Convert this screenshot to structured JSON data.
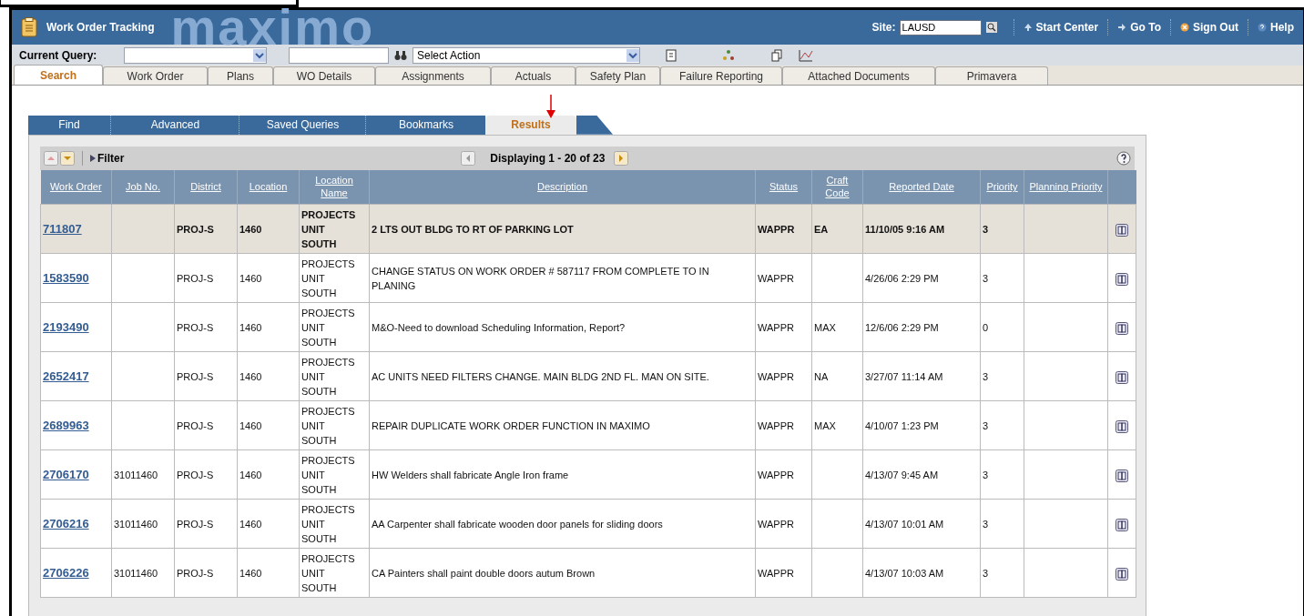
{
  "app": {
    "title": "Work Order Tracking",
    "brand": "maximo"
  },
  "site": {
    "label": "Site:",
    "value": "LAUSD"
  },
  "nav_links": [
    {
      "label": "Start Center",
      "kind": "home"
    },
    {
      "label": "Go To",
      "kind": "goto"
    },
    {
      "label": "Sign Out",
      "kind": "signout"
    },
    {
      "label": "Help",
      "kind": "help"
    }
  ],
  "query_bar": {
    "label": "Current Query:",
    "action": "Select Action"
  },
  "tabs": [
    {
      "label": "Search",
      "selected": true
    },
    {
      "label": "Work Order",
      "selected": false
    },
    {
      "label": "Plans",
      "selected": false
    },
    {
      "label": "WO Details",
      "selected": false
    },
    {
      "label": "Assignments",
      "selected": false
    },
    {
      "label": "Actuals",
      "selected": false
    },
    {
      "label": "Safety Plan",
      "selected": false
    },
    {
      "label": "Failure Reporting",
      "selected": false
    },
    {
      "label": "Attached Documents",
      "selected": false
    },
    {
      "label": "Primavera",
      "selected": false
    }
  ],
  "subtabs": [
    {
      "label": "Find",
      "selected": false
    },
    {
      "label": "Advanced",
      "selected": false
    },
    {
      "label": "Saved Queries",
      "selected": false
    },
    {
      "label": "Bookmarks",
      "selected": false
    },
    {
      "label": "Results",
      "selected": true
    }
  ],
  "results": {
    "filter": "Filter",
    "paging": "Displaying 1 - 20 of 23",
    "columns": [
      "Work Order",
      "Job No.",
      "District",
      "Location",
      "Location Name",
      "Description",
      "Status",
      "Craft Code",
      "Reported Date",
      "Priority",
      "Planning Priority"
    ],
    "rows": [
      {
        "selected": true,
        "cells": [
          "711807",
          "",
          "PROJ-S",
          "1460",
          "PROJECTS UNIT SOUTH",
          "2 LTS OUT BLDG TO RT OF PARKING LOT",
          "WAPPR",
          "EA",
          "11/10/05 9:16 AM",
          "3",
          ""
        ]
      },
      {
        "selected": false,
        "cells": [
          "1583590",
          "",
          "PROJ-S",
          "1460",
          "PROJECTS UNIT SOUTH",
          "CHANGE STATUS ON WORK ORDER # 587117 FROM COMPLETE TO IN PLANING",
          "WAPPR",
          "",
          "4/26/06 2:29 PM",
          "3",
          ""
        ]
      },
      {
        "selected": false,
        "cells": [
          "2193490",
          "",
          "PROJ-S",
          "1460",
          "PROJECTS UNIT SOUTH",
          "M&O-Need to download Scheduling Information, Report?",
          "WAPPR",
          "MAX",
          "12/6/06 2:29 PM",
          "0",
          ""
        ]
      },
      {
        "selected": false,
        "cells": [
          "2652417",
          "",
          "PROJ-S",
          "1460",
          "PROJECTS UNIT SOUTH",
          "AC UNITS NEED FILTERS CHANGE. MAIN BLDG 2ND FL. MAN ON SITE.",
          "WAPPR",
          "NA",
          "3/27/07 11:14 AM",
          "3",
          ""
        ]
      },
      {
        "selected": false,
        "cells": [
          "2689963",
          "",
          "PROJ-S",
          "1460",
          "PROJECTS UNIT SOUTH",
          "REPAIR DUPLICATE WORK ORDER FUNCTION IN MAXIMO",
          "WAPPR",
          "MAX",
          "4/10/07 1:23 PM",
          "3",
          ""
        ]
      },
      {
        "selected": false,
        "cells": [
          "2706170",
          "31011460",
          "PROJ-S",
          "1460",
          "PROJECTS UNIT SOUTH",
          "HW Welders shall fabricate Angle Iron frame",
          "WAPPR",
          "",
          "4/13/07 9:45 AM",
          "3",
          ""
        ]
      },
      {
        "selected": false,
        "cells": [
          "2706216",
          "31011460",
          "PROJ-S",
          "1460",
          "PROJECTS UNIT SOUTH",
          "AA Carpenter shall fabricate wooden door panels for sliding doors",
          "WAPPR",
          "",
          "4/13/07 10:01 AM",
          "3",
          ""
        ]
      },
      {
        "selected": false,
        "cells": [
          "2706226",
          "31011460",
          "PROJ-S",
          "1460",
          "PROJECTS UNIT SOUTH",
          "CA Painters shall paint double doors autum Brown",
          "WAPPR",
          "",
          "4/13/07 10:03 AM",
          "3",
          ""
        ]
      }
    ]
  }
}
